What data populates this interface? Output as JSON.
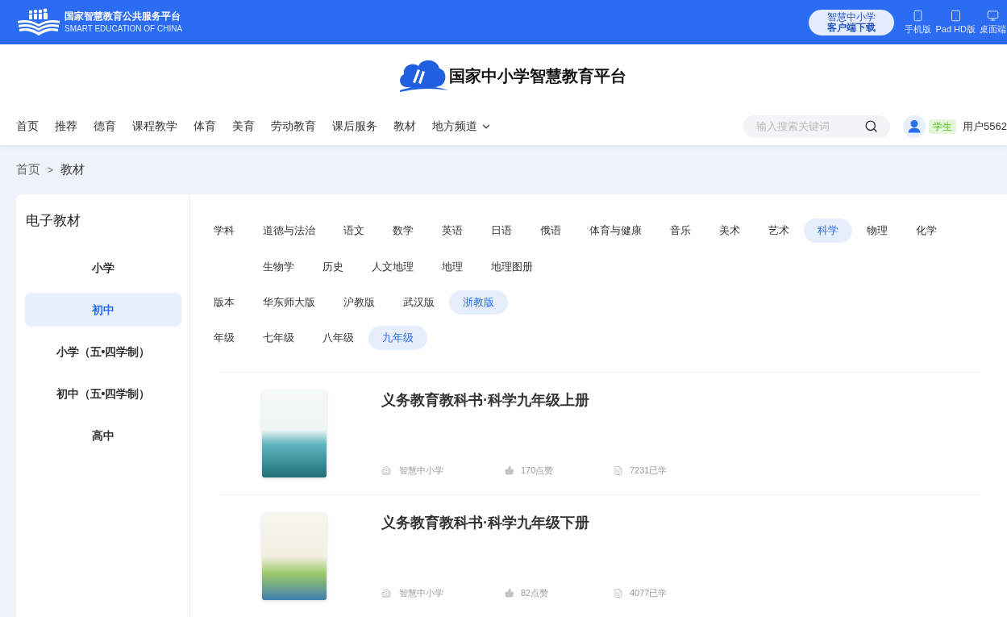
{
  "top_bar": {
    "logo": {
      "title": "国家智慧教育公共服务平台",
      "subtitle": "SMART EDUCATION OF CHINA"
    },
    "download_button": {
      "line_1": "智慧中小学",
      "line_2": "客户端下载"
    },
    "device_links": [
      {
        "kind": "phone",
        "label": "手机版"
      },
      {
        "kind": "tablet",
        "label": "Pad HD版"
      },
      {
        "kind": "desktop",
        "label": "桌面端"
      }
    ]
  },
  "header": {
    "platform_title": "国家中小学智慧教育平台",
    "nav": [
      {
        "label": "首页",
        "kind": "link"
      },
      {
        "label": "推荐",
        "kind": "link"
      },
      {
        "label": "德育",
        "kind": "link"
      },
      {
        "label": "课程教学",
        "kind": "link"
      },
      {
        "label": "体育",
        "kind": "link"
      },
      {
        "label": "美育",
        "kind": "link"
      },
      {
        "label": "劳动教育",
        "kind": "link"
      },
      {
        "label": "课后服务",
        "kind": "link"
      },
      {
        "label": "教材",
        "kind": "link"
      },
      {
        "label": "地方频道",
        "kind": "dropdown"
      }
    ],
    "search": {
      "placeholder": "输入搜索关键词"
    },
    "user": {
      "role_badge": "学生",
      "name": "用户5562"
    }
  },
  "breadcrumb": {
    "items": [
      "首页",
      "教材"
    ],
    "separator": ">"
  },
  "sidebar": {
    "title": "电子教材",
    "items": [
      {
        "label": "小学",
        "selected": false
      },
      {
        "label": "初中",
        "selected": true
      },
      {
        "label": "小学（五•四学制）",
        "selected": false
      },
      {
        "label": "初中（五•四学制）",
        "selected": false
      },
      {
        "label": "高中",
        "selected": false
      }
    ]
  },
  "filters": [
    {
      "label": "学科",
      "options": [
        {
          "label": "道德与法治",
          "selected": false
        },
        {
          "label": "语文",
          "selected": false
        },
        {
          "label": "数学",
          "selected": false
        },
        {
          "label": "英语",
          "selected": false
        },
        {
          "label": "日语",
          "selected": false
        },
        {
          "label": "俄语",
          "selected": false
        },
        {
          "label": "体育与健康",
          "selected": false
        },
        {
          "label": "音乐",
          "selected": false
        },
        {
          "label": "美术",
          "selected": false
        },
        {
          "label": "艺术",
          "selected": false
        },
        {
          "label": "科学",
          "selected": true
        },
        {
          "label": "物理",
          "selected": false
        },
        {
          "label": "化学",
          "selected": false
        },
        {
          "label": "生物学",
          "selected": false
        },
        {
          "label": "历史",
          "selected": false
        },
        {
          "label": "人文地理",
          "selected": false
        },
        {
          "label": "地理",
          "selected": false
        },
        {
          "label": "地理图册",
          "selected": false
        }
      ]
    },
    {
      "label": "版本",
      "options": [
        {
          "label": "华东师大版",
          "selected": false
        },
        {
          "label": "沪教版",
          "selected": false
        },
        {
          "label": "武汉版",
          "selected": false
        },
        {
          "label": "浙教版",
          "selected": true
        }
      ]
    },
    {
      "label": "年级",
      "options": [
        {
          "label": "七年级",
          "selected": false
        },
        {
          "label": "八年级",
          "selected": false
        },
        {
          "label": "九年级",
          "selected": true
        }
      ]
    }
  ],
  "books": [
    {
      "title": "义务教育教科书·科学九年级上册",
      "publisher": "智慧中小学",
      "likes": "170点赞",
      "learners": "7231已学"
    },
    {
      "title": "义务教育教科书·科学九年级下册",
      "publisher": "智慧中小学",
      "likes": "82点赞",
      "learners": "4077已学"
    }
  ]
}
